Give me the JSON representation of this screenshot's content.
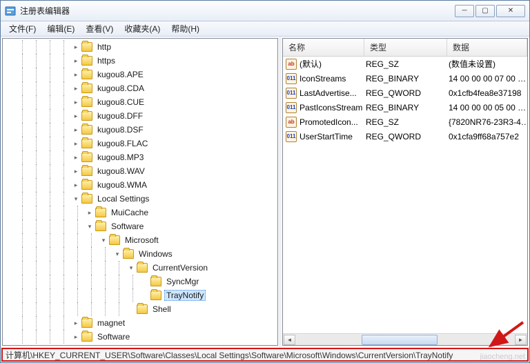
{
  "window": {
    "title": "注册表编辑器"
  },
  "menu": {
    "file": "文件(F)",
    "edit": "编辑(E)",
    "view": "查看(V)",
    "favorites": "收藏夹(A)",
    "help": "帮助(H)"
  },
  "tree": {
    "nodes": [
      {
        "depth": 5,
        "toggle": "closed",
        "label": "http"
      },
      {
        "depth": 5,
        "toggle": "closed",
        "label": "https"
      },
      {
        "depth": 5,
        "toggle": "closed",
        "label": "kugou8.APE"
      },
      {
        "depth": 5,
        "toggle": "closed",
        "label": "kugou8.CDA"
      },
      {
        "depth": 5,
        "toggle": "closed",
        "label": "kugou8.CUE"
      },
      {
        "depth": 5,
        "toggle": "closed",
        "label": "kugou8.DFF"
      },
      {
        "depth": 5,
        "toggle": "closed",
        "label": "kugou8.DSF"
      },
      {
        "depth": 5,
        "toggle": "closed",
        "label": "kugou8.FLAC"
      },
      {
        "depth": 5,
        "toggle": "closed",
        "label": "kugou8.MP3"
      },
      {
        "depth": 5,
        "toggle": "closed",
        "label": "kugou8.WAV"
      },
      {
        "depth": 5,
        "toggle": "closed",
        "label": "kugou8.WMA"
      },
      {
        "depth": 5,
        "toggle": "open",
        "label": "Local Settings"
      },
      {
        "depth": 6,
        "toggle": "closed",
        "label": "MuiCache"
      },
      {
        "depth": 6,
        "toggle": "open",
        "label": "Software"
      },
      {
        "depth": 7,
        "toggle": "open",
        "label": "Microsoft"
      },
      {
        "depth": 8,
        "toggle": "open",
        "label": "Windows"
      },
      {
        "depth": 9,
        "toggle": "open",
        "label": "CurrentVersion"
      },
      {
        "depth": 10,
        "toggle": "none",
        "label": "SyncMgr"
      },
      {
        "depth": 10,
        "toggle": "none",
        "label": "TrayNotify",
        "selected": true
      },
      {
        "depth": 9,
        "toggle": "none",
        "label": "Shell"
      },
      {
        "depth": 5,
        "toggle": "closed",
        "label": "magnet"
      },
      {
        "depth": 5,
        "toggle": "closed",
        "label": "Software"
      }
    ]
  },
  "list": {
    "headers": {
      "name": "名称",
      "type": "类型",
      "data": "数据"
    },
    "rows": [
      {
        "icon": "str",
        "name": "(默认)",
        "type": "REG_SZ",
        "data": "(数值未设置)"
      },
      {
        "icon": "bin",
        "name": "IconStreams",
        "type": "REG_BINARY",
        "data": "14 00 00 00 07 00 …"
      },
      {
        "icon": "bin",
        "name": "LastAdvertise...",
        "type": "REG_QWORD",
        "data": "0x1cfb4fea8e37198"
      },
      {
        "icon": "bin",
        "name": "PastIconsStream",
        "type": "REG_BINARY",
        "data": "14 00 00 00 05 00 …"
      },
      {
        "icon": "str",
        "name": "PromotedIcon...",
        "type": "REG_SZ",
        "data": "{7820NR76-23R3-4…"
      },
      {
        "icon": "bin",
        "name": "UserStartTime",
        "type": "REG_QWORD",
        "data": "0x1cfa9ff68a757e2"
      }
    ]
  },
  "statusbar": {
    "path": "计算机\\HKEY_CURRENT_USER\\Software\\Classes\\Local Settings\\Software\\Microsoft\\Windows\\CurrentVersion\\TrayNotify"
  },
  "watermark": "jiaocheng.net"
}
